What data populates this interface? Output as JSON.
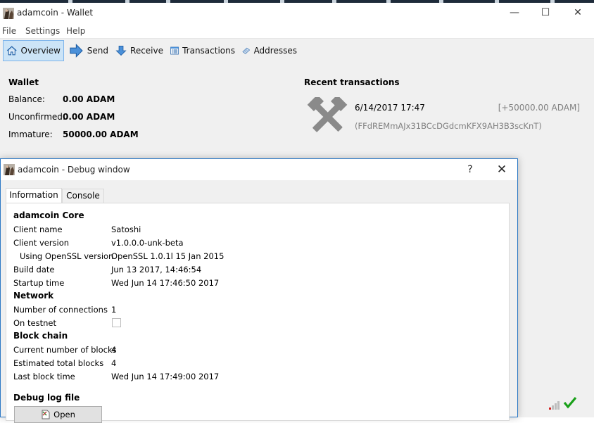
{
  "main_window": {
    "title": "adamcoin - Wallet",
    "controls": {
      "minimize": "—",
      "maximize": "☐",
      "close": "✕"
    }
  },
  "menu": [
    "File",
    "Settings",
    "Help"
  ],
  "toolbar": {
    "items": [
      {
        "label": "Overview",
        "icon": "home-icon",
        "active": true
      },
      {
        "label": "Send",
        "icon": "send-arrow-icon"
      },
      {
        "label": "Receive",
        "icon": "receive-arrow-icon"
      },
      {
        "label": "Transactions",
        "icon": "transactions-list-icon"
      },
      {
        "label": "Addresses",
        "icon": "address-book-icon"
      }
    ]
  },
  "wallet": {
    "heading": "Wallet",
    "rows": [
      {
        "label": "Balance:",
        "value": "0.00 ADAM"
      },
      {
        "label": "Unconfirmed:",
        "value": "0.00 ADAM"
      },
      {
        "label": "Immature:",
        "value": "50000.00 ADAM"
      }
    ]
  },
  "recent": {
    "heading": "Recent transactions",
    "transactions": [
      {
        "icon": "mining-hammers-icon",
        "date": "6/14/2017 17:47",
        "amount": "[+50000.00 ADAM]",
        "address": "(FFdREMmAJx31BCcDGdcmKFX9AH3B3scKnT)"
      }
    ]
  },
  "status_bar": {
    "icons": [
      "network-signal-icon",
      "synced-checkmark-icon"
    ],
    "accent": "#19a019"
  },
  "debug_window": {
    "title": "adamcoin - Debug window",
    "help": "?",
    "close": "✕",
    "tabs": [
      "Information",
      "Console"
    ],
    "active_tab": "Information",
    "sections": {
      "core": "adamcoin Core",
      "network": "Network",
      "blockchain": "Block chain",
      "debuglog": "Debug log file"
    },
    "info": {
      "client_name": {
        "label": "Client name",
        "value": "Satoshi"
      },
      "client_version": {
        "label": "Client version",
        "value": "v1.0.0.0-unk-beta"
      },
      "openssl": {
        "label": "Using OpenSSL version",
        "value": "OpenSSL 1.0.1l 15 Jan 2015"
      },
      "build_date": {
        "label": "Build date",
        "value": "Jun 13 2017, 14:46:54"
      },
      "startup_time": {
        "label": "Startup time",
        "value": "Wed Jun 14 17:46:50 2017"
      },
      "connections": {
        "label": "Number of connections",
        "value": "1"
      },
      "testnet": {
        "label": "On testnet",
        "checked": false
      },
      "current_blocks": {
        "label": "Current number of blocks",
        "value": "4"
      },
      "total_blocks": {
        "label": "Estimated total blocks",
        "value": "4"
      },
      "last_block_time": {
        "label": "Last block time",
        "value": "Wed Jun 14 17:49:00 2017"
      }
    },
    "open_button": "Open"
  }
}
